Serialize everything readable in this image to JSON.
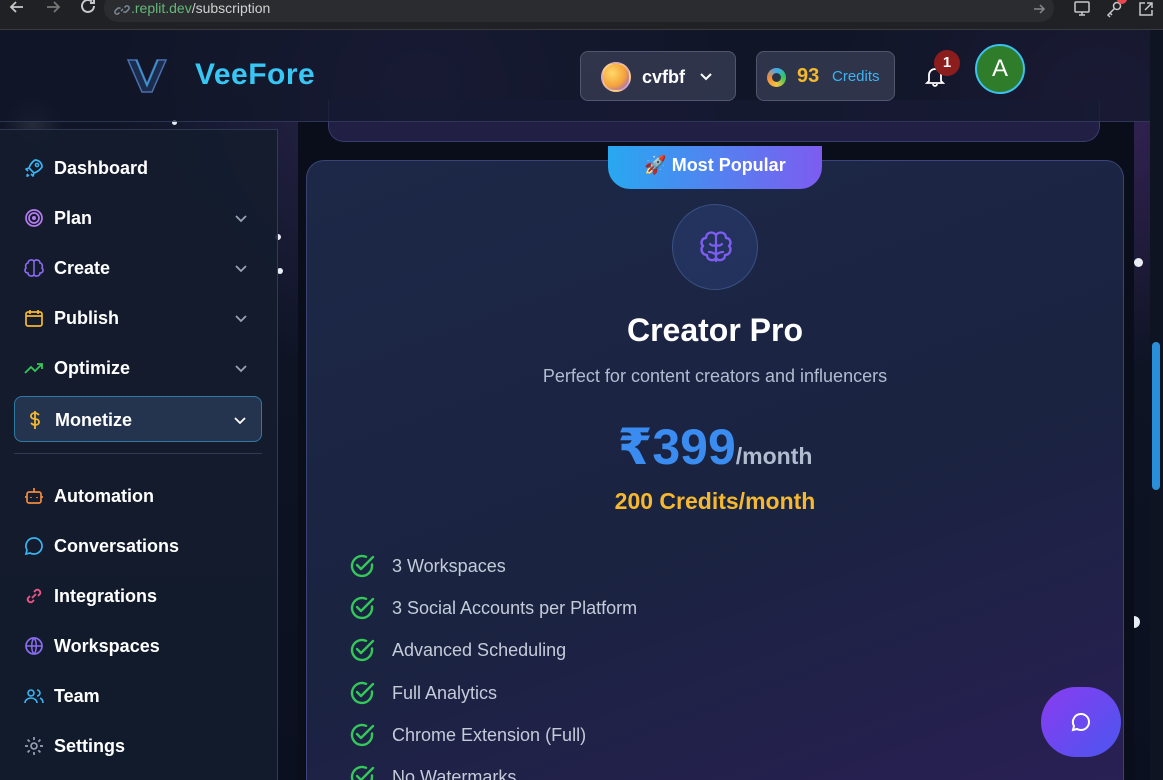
{
  "browser": {
    "url_host": ".replit.dev",
    "url_path": "/subscription"
  },
  "header": {
    "brand": "VeeFore",
    "workspace_name": "cvfbf",
    "credits_count": "93",
    "credits_label": "Credits",
    "notification_count": "1",
    "user_initial": "A"
  },
  "sidebar": {
    "items": [
      {
        "label": "Dashboard",
        "icon": "rocket-icon",
        "color": "#3ab4f2"
      },
      {
        "label": "Plan",
        "icon": "target-icon",
        "color": "#b57cf0"
      },
      {
        "label": "Create",
        "icon": "brain-icon",
        "color": "#8b6cf0"
      },
      {
        "label": "Publish",
        "icon": "calendar-icon",
        "color": "#f5b82e"
      },
      {
        "label": "Optimize",
        "icon": "trending-up-icon",
        "color": "#34c759"
      },
      {
        "label": "Monetize",
        "icon": "dollar-icon",
        "color": "#f5b82e"
      },
      {
        "label": "Automation",
        "icon": "bot-icon",
        "color": "#f08a3c"
      },
      {
        "label": "Conversations",
        "icon": "chat-bubble-icon",
        "color": "#3ab4f2"
      },
      {
        "label": "Integrations",
        "icon": "link-icon",
        "color": "#f0558a"
      },
      {
        "label": "Workspaces",
        "icon": "globe-icon",
        "color": "#8b6cf0"
      },
      {
        "label": "Team",
        "icon": "users-icon",
        "color": "#3ab4f2"
      },
      {
        "label": "Settings",
        "icon": "gear-icon",
        "color": "#9aa3b5"
      }
    ]
  },
  "plan": {
    "badge": "🚀 Most Popular",
    "name": "Creator Pro",
    "description": "Perfect for content creators and influencers",
    "price": "₹399",
    "period": "/month",
    "credits": "200 Credits/month",
    "features": [
      "3 Workspaces",
      "3 Social Accounts per Platform",
      "Advanced Scheduling",
      "Full Analytics",
      "Chrome Extension (Full)",
      "No Watermarks"
    ]
  },
  "colors": {
    "accent": "#3ab4f2",
    "price": "#3b8cf0",
    "credits": "#f5b82e",
    "check": "#34c759"
  }
}
